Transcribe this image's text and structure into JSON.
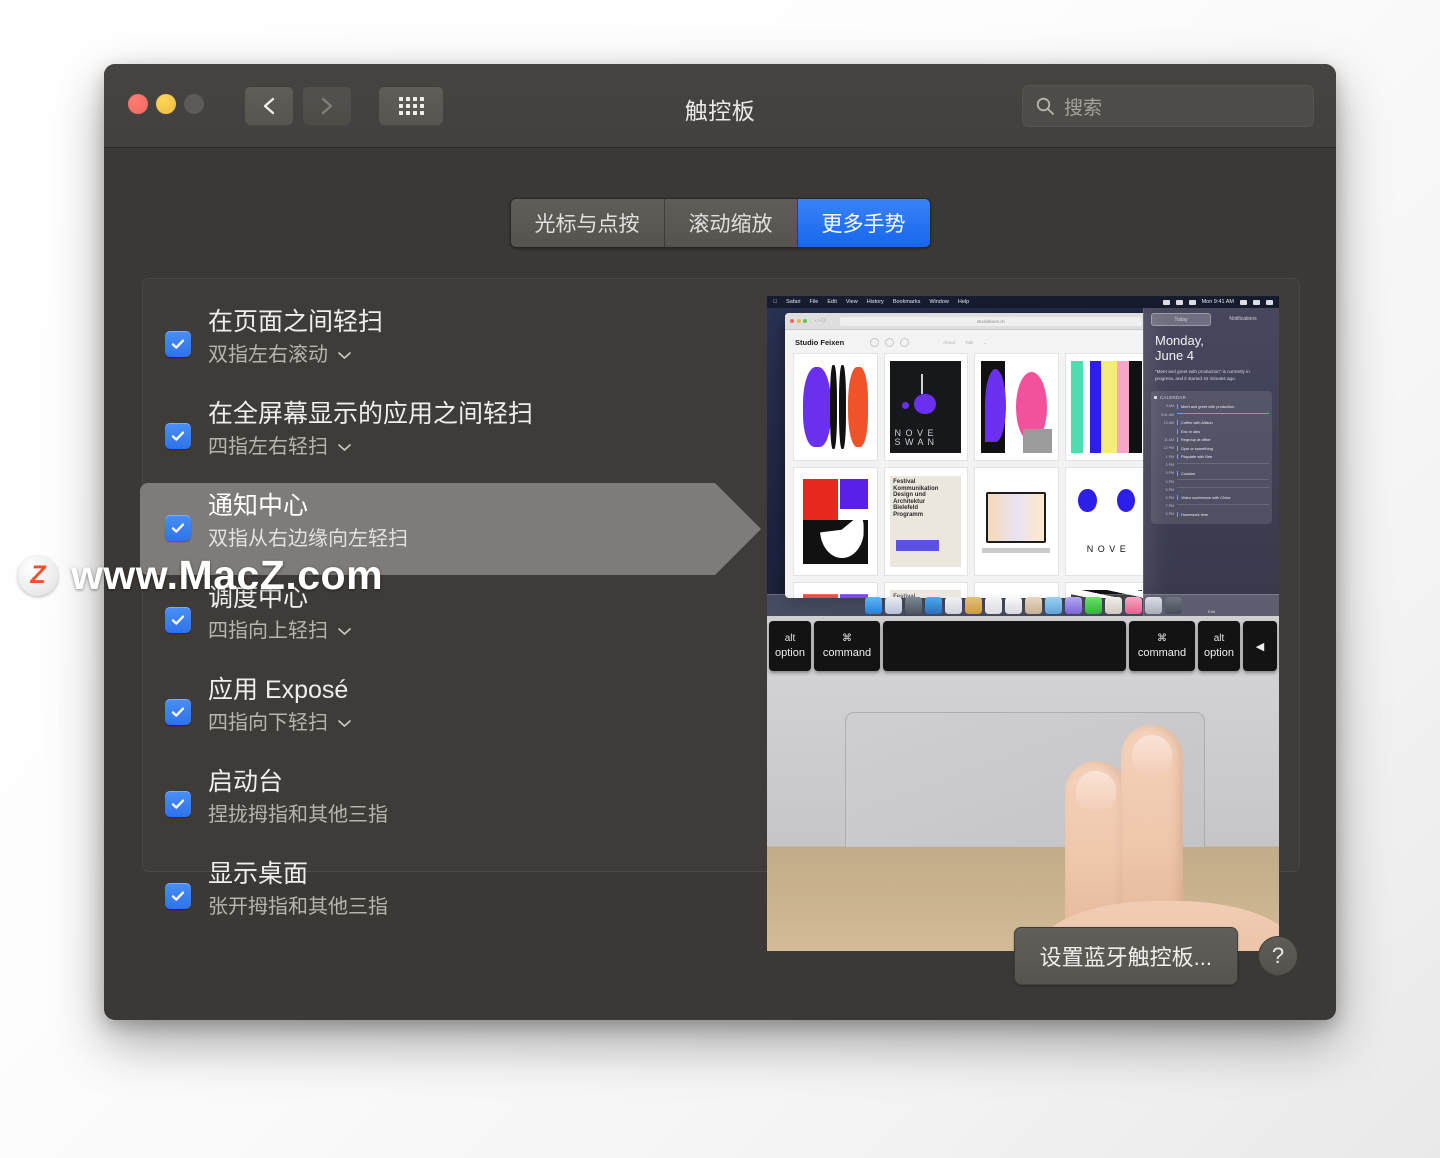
{
  "window": {
    "title": "触控板",
    "traffic_lights": [
      "close",
      "minimize",
      "zoom"
    ],
    "nav": {
      "back_icon": "chevron-left-icon",
      "forward_icon": "chevron-right-icon",
      "grid_icon": "grid-icon"
    },
    "search": {
      "placeholder": "搜索",
      "value": "",
      "icon": "search-icon"
    }
  },
  "tabs": [
    {
      "label": "光标与点按",
      "active": false
    },
    {
      "label": "滚动缩放",
      "active": false
    },
    {
      "label": "更多手势",
      "active": true
    }
  ],
  "gestures": [
    {
      "title": "在页面之间轻扫",
      "sub": "双指左右滚动",
      "checked": true,
      "has_menu": true,
      "highlighted": false
    },
    {
      "title": "在全屏幕显示的应用之间轻扫",
      "sub": "四指左右轻扫",
      "checked": true,
      "has_menu": true,
      "highlighted": false
    },
    {
      "title": "通知中心",
      "sub": "双指从右边缘向左轻扫",
      "checked": true,
      "has_menu": false,
      "highlighted": true
    },
    {
      "title": "调度中心",
      "sub": "四指向上轻扫",
      "checked": true,
      "has_menu": true,
      "highlighted": false
    },
    {
      "title": "应用 Exposé",
      "sub": "四指向下轻扫",
      "checked": true,
      "has_menu": true,
      "highlighted": false
    },
    {
      "title": "启动台",
      "sub": "捏拢拇指和其他三指",
      "checked": true,
      "has_menu": false,
      "highlighted": false
    },
    {
      "title": "显示桌面",
      "sub": "张开拇指和其他三指",
      "checked": true,
      "has_menu": false,
      "highlighted": false
    }
  ],
  "footer": {
    "bluetooth_button": "设置蓝牙触控板...",
    "help_button": "?"
  },
  "preview": {
    "menubar": {
      "apple": "",
      "items": [
        "Safari",
        "File",
        "Edit",
        "View",
        "History",
        "Bookmarks",
        "Window",
        "Help"
      ],
      "clock": "Mon 9:41 AM"
    },
    "safari": {
      "url": "studiofeixen.ch",
      "brand": "Studio Feixen",
      "menu": [
        "About",
        "Talk",
        "⌄"
      ]
    },
    "notification_center": {
      "tabs": [
        "Today",
        "Notifications"
      ],
      "active_tab": "Today",
      "date_line1": "Monday,",
      "date_line2": "June 4",
      "blurb": "\"Meet and greet with production\" is currently in progress, and it started 42 minutes ago.",
      "widget_title": "CALENDAR",
      "events": [
        {
          "time": "9 AM",
          "label": "Meet and greet with production"
        },
        {
          "time": "9:41 AM",
          "label": ""
        },
        {
          "time": "10 AM",
          "label": "Coffee with Allison"
        },
        {
          "time": "",
          "label": "Eric in labs"
        },
        {
          "time": "11 AM",
          "label": "Regroup at office"
        },
        {
          "time": "12 PM",
          "label": "Gym or something"
        },
        {
          "time": "1 PM",
          "label": "Playdate with Brie"
        },
        {
          "time": "2 PM",
          "label": ""
        },
        {
          "time": "3 PM",
          "label": "Cookies"
        },
        {
          "time": "4 PM",
          "label": ""
        },
        {
          "time": "5 PM",
          "label": ""
        },
        {
          "time": "5 PM",
          "label": "Video conference with China"
        },
        {
          "time": "7 PM",
          "label": ""
        },
        {
          "time": "8 PM",
          "label": "Homework time"
        }
      ],
      "footer": "Edit"
    },
    "keyboard": [
      {
        "top": "alt",
        "bottom": "option",
        "type": "opt"
      },
      {
        "top": "⌘",
        "bottom": "command",
        "type": "cmd"
      },
      {
        "top": "",
        "bottom": "",
        "type": "space"
      },
      {
        "top": "⌘",
        "bottom": "command",
        "type": "cmd"
      },
      {
        "top": "alt",
        "bottom": "option",
        "type": "opt"
      },
      {
        "top": "",
        "bottom": "◀",
        "type": "arrow"
      }
    ]
  },
  "watermark": {
    "badge": "Z",
    "text": "www.MacZ.com"
  },
  "colors": {
    "accent_blue": "#3b7ef0",
    "window_bg": "#3b3835",
    "panel_bg": "#3e3b38",
    "highlight": "#7e7b78",
    "title_text": "#f0eeec",
    "sub_text": "#b8b4b0"
  }
}
